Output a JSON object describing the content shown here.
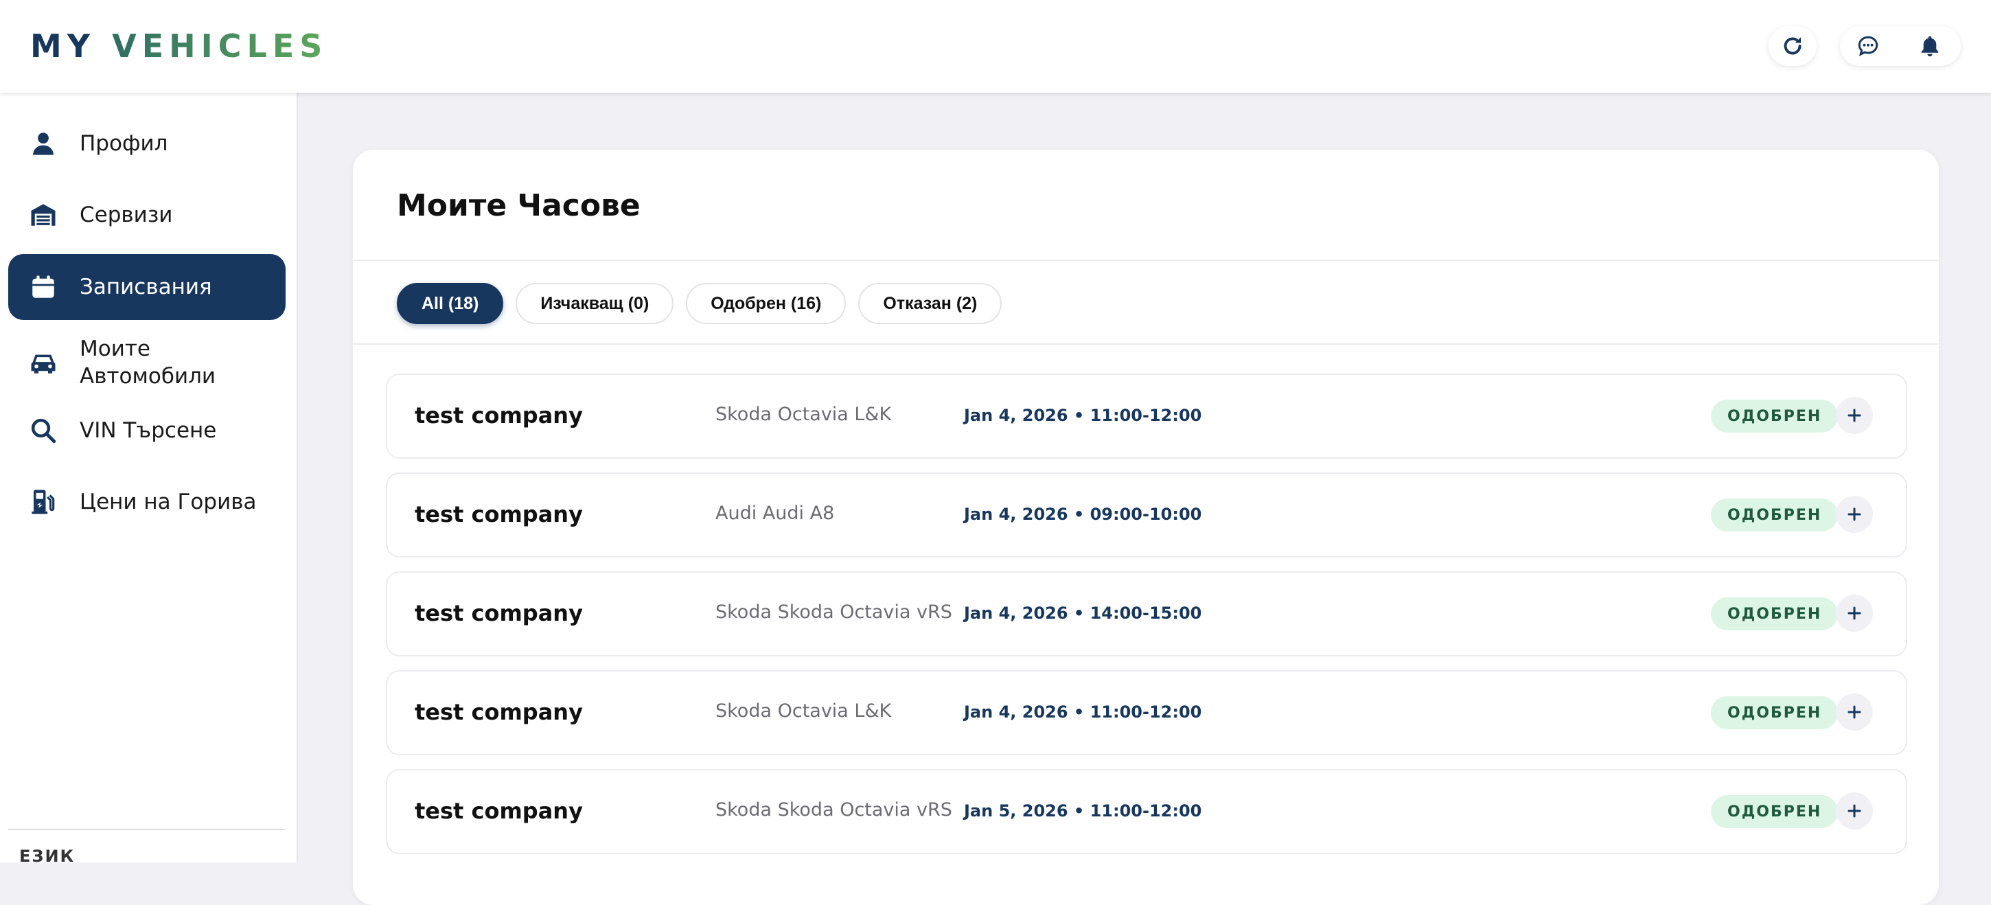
{
  "header": {
    "brand_part1": "MY",
    "brand_part2": "VEHICLES",
    "icons": [
      "refresh-icon",
      "chat-icon",
      "bell-icon"
    ]
  },
  "sidebar": {
    "items": [
      {
        "label": "Профил",
        "icon": "user-icon",
        "active": false
      },
      {
        "label": "Сервизи",
        "icon": "garage-icon",
        "active": false
      },
      {
        "label": "Записвания",
        "icon": "calendar-icon",
        "active": true
      },
      {
        "label": "Моите Автомобили",
        "icon": "car-icon",
        "active": false
      },
      {
        "label": "VIN Търсене",
        "icon": "search-icon",
        "active": false
      },
      {
        "label": "Цени на Горива",
        "icon": "fuel-pump-icon",
        "active": false
      }
    ],
    "language_label": "ЕЗИК"
  },
  "main": {
    "title": "Моите Часове",
    "filters": [
      {
        "label": "All (18)",
        "active": true
      },
      {
        "label": "Изчакващ (0)",
        "active": false
      },
      {
        "label": "Одобрен (16)",
        "active": false
      },
      {
        "label": "Отказан (2)",
        "active": false
      }
    ],
    "appointments": [
      {
        "company": "test company",
        "vehicle": "Skoda Octavia L&K",
        "datetime": "Jan 4, 2026 • 11:00-12:00",
        "status": "ОДОБРЕН"
      },
      {
        "company": "test company",
        "vehicle": "Audi Audi A8",
        "datetime": "Jan 4, 2026 • 09:00-10:00",
        "status": "ОДОБРЕН"
      },
      {
        "company": "test company",
        "vehicle": "Skoda Skoda Octavia vRS",
        "datetime": "Jan 4, 2026 • 14:00-15:00",
        "status": "ОДОБРЕН"
      },
      {
        "company": "test company",
        "vehicle": "Skoda Octavia L&K",
        "datetime": "Jan 4, 2026 • 11:00-12:00",
        "status": "ОДОБРЕН"
      },
      {
        "company": "test company",
        "vehicle": "Skoda Skoda Octavia vRS",
        "datetime": "Jan 5, 2026 • 11:00-12:00",
        "status": "ОДОБРЕН"
      }
    ]
  },
  "colors": {
    "primary": "#17375f",
    "accent_green": "#5ba85a",
    "status_bg": "#dcf5e5",
    "status_text": "#1f5a3c",
    "page_bg": "#f1f1f5"
  }
}
